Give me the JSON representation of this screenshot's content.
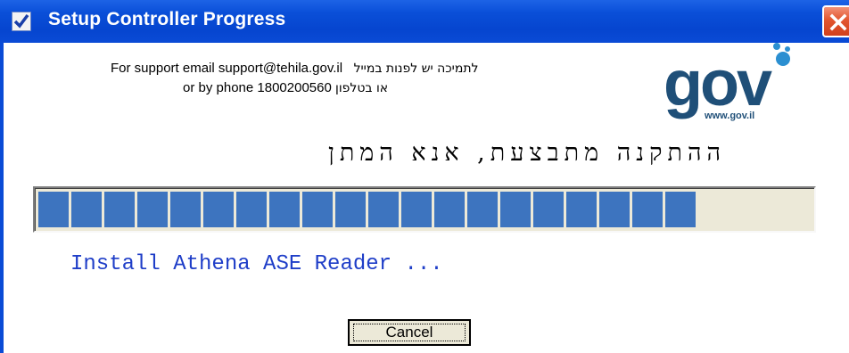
{
  "window": {
    "title": "Setup Controller Progress",
    "close_icon": "close-icon",
    "app_icon": "checkmark-icon"
  },
  "support": {
    "line1_english": "For support email support@tehila.gov.il",
    "line1_hebrew": "לתמיכה יש לפנות במייל",
    "line2_english": "or by phone 1800200560",
    "line2_hebrew": "או בטלפון"
  },
  "logo": {
    "text": "gov",
    "url": "www.gov.il"
  },
  "heading": "ההתקנה מתבצעת, אנא המתן",
  "progress": {
    "value": 0.84,
    "filled_blocks": 20,
    "fill_color": "#3d74bf"
  },
  "status": "Install Athena ASE Reader ...",
  "buttons": {
    "cancel": "Cancel"
  }
}
